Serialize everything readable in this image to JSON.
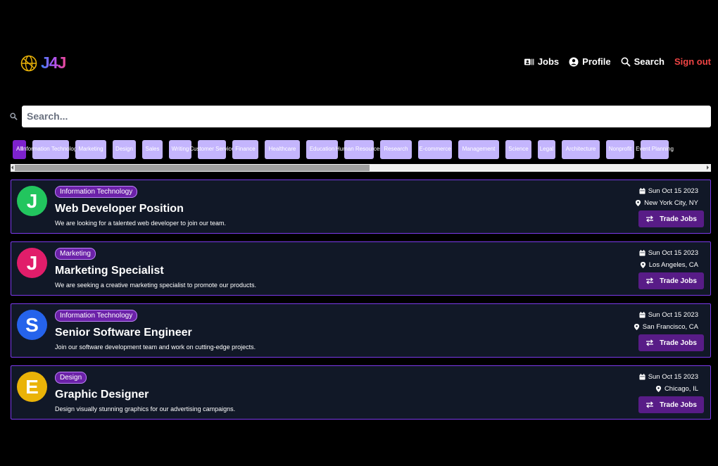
{
  "header": {
    "logo_text": "J4J",
    "nav": {
      "jobs": "Jobs",
      "profile": "Profile",
      "search": "Search",
      "signout": "Sign out"
    }
  },
  "search": {
    "placeholder": "Search..."
  },
  "categories": [
    {
      "label": "All",
      "active": true
    },
    {
      "label": "Information Technology"
    },
    {
      "label": "Marketing"
    },
    {
      "label": "Design"
    },
    {
      "label": "Sales"
    },
    {
      "label": "Writing"
    },
    {
      "label": "Customer Service"
    },
    {
      "label": "Finance"
    },
    {
      "label": "Healthcare"
    },
    {
      "label": "Education"
    },
    {
      "label": "Human Resources"
    },
    {
      "label": "Research"
    },
    {
      "label": "E-commerce"
    },
    {
      "label": "Management"
    },
    {
      "label": "Science"
    },
    {
      "label": "Legal"
    },
    {
      "label": "Architecture"
    },
    {
      "label": "Nonprofit"
    },
    {
      "label": "Event Planning"
    }
  ],
  "jobs": [
    {
      "initial": "J",
      "avatar_color": "#22c55e",
      "category": "Information Technology",
      "title": "Web Developer Position",
      "description": "We are looking for a talented web developer to join our team.",
      "date": "Sun Oct 15 2023",
      "location": "New York City, NY",
      "action": "Trade Jobs"
    },
    {
      "initial": "J",
      "avatar_color": "#e11d6a",
      "category": "Marketing",
      "title": "Marketing Specialist",
      "description": "We are seeking a creative marketing specialist to promote our products.",
      "date": "Sun Oct 15 2023",
      "location": "Los Angeles, CA",
      "action": "Trade Jobs"
    },
    {
      "initial": "S",
      "avatar_color": "#2563eb",
      "category": "Information Technology",
      "title": "Senior Software Engineer",
      "description": "Join our software development team and work on cutting-edge projects.",
      "date": "Sun Oct 15 2023",
      "location": "San Francisco, CA",
      "action": "Trade Jobs"
    },
    {
      "initial": "E",
      "avatar_color": "#eab308",
      "category": "Design",
      "title": "Graphic Designer",
      "description": "Design visually stunning graphics for our advertising campaigns.",
      "date": "Sun Oct 15 2023",
      "location": "Chicago, IL",
      "action": "Trade Jobs"
    }
  ]
}
